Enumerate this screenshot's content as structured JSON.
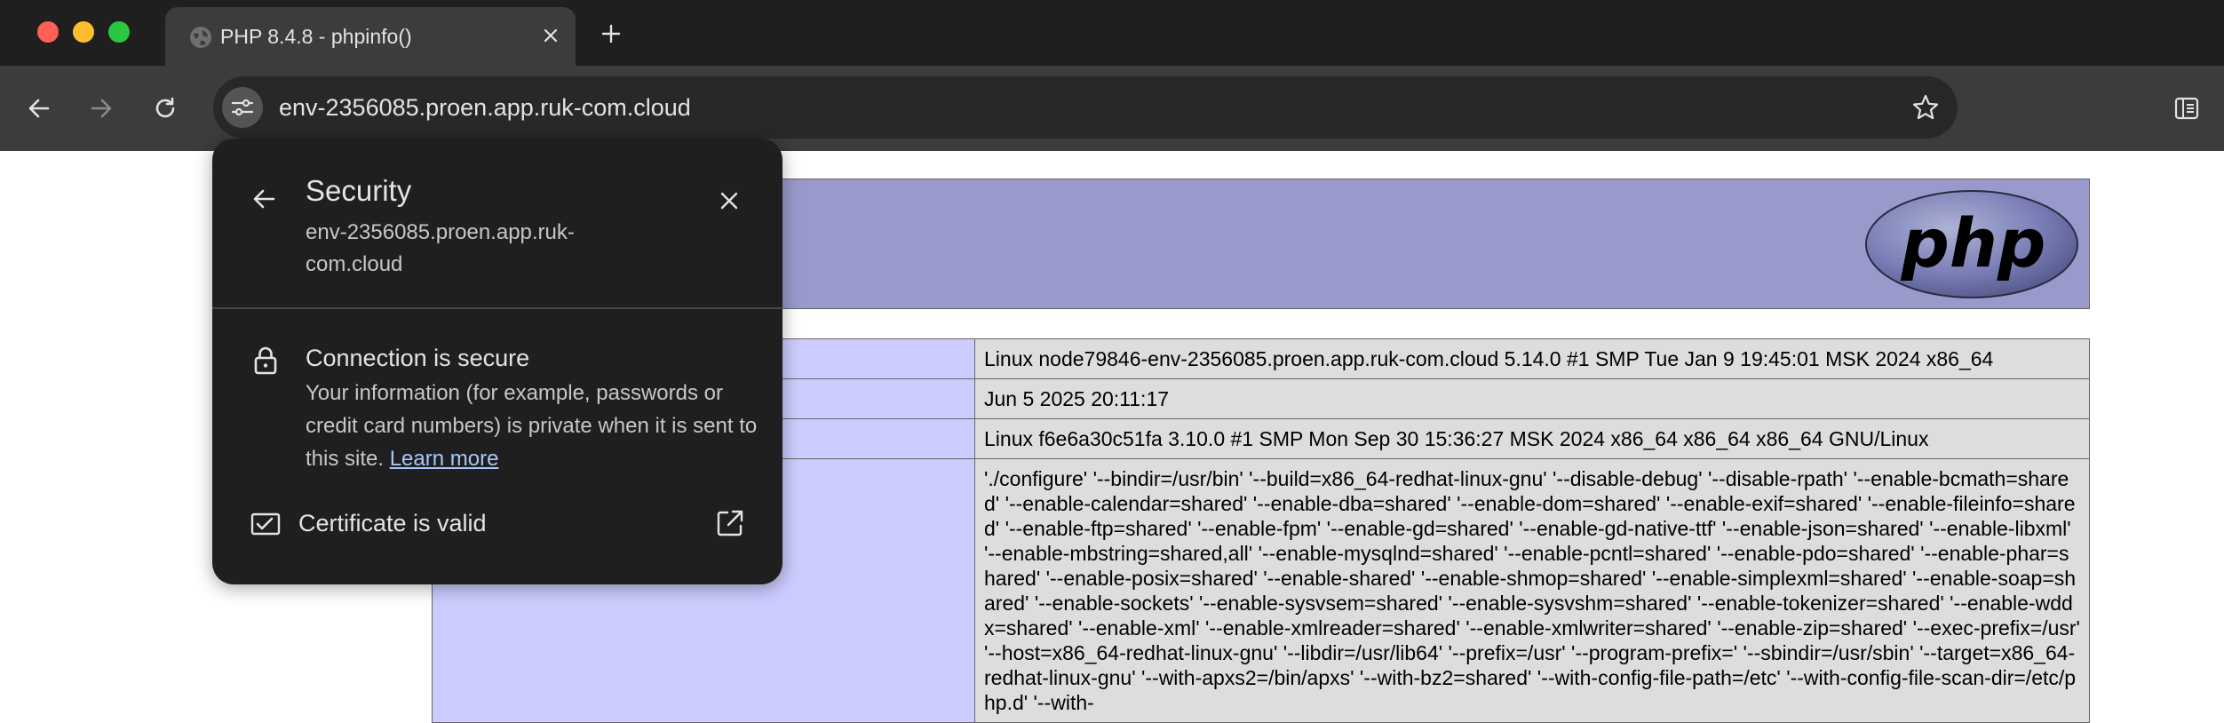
{
  "browser": {
    "tab": {
      "title": "PHP 8.4.8 - phpinfo()",
      "favicon": "globe-icon"
    },
    "toolbar": {
      "url": "env-2356085.proen.app.ruk-com.cloud",
      "icons": [
        "back-icon",
        "forward-icon",
        "reload-icon",
        "site-info-icon",
        "bookmark-star-icon",
        "side-panel-icon"
      ]
    }
  },
  "security_popup": {
    "title": "Security",
    "host": "env-2356085.proen.app.ruk-com.cloud",
    "connection_title": "Connection is secure",
    "connection_desc": "Your information (for example, passwords or credit card numbers) is private when it is sent to this site.",
    "learn_more": "Learn more",
    "certificate_label": "Certificate is valid"
  },
  "phpinfo": {
    "logo_text": "php",
    "rows": [
      {
        "key": "",
        "value": "Linux node79846-env-2356085.proen.app.ruk-com.cloud 5.14.0 #1 SMP Tue Jan 9 19:45:01 MSK 2024 x86_64"
      },
      {
        "key": "",
        "value": "Jun 5 2025 20:11:17"
      },
      {
        "key": "",
        "value": "Linux f6e6a30c51fa 3.10.0 #1 SMP Mon Sep 30 15:36:27 MSK 2024 x86_64 x86_64 x86_64 GNU/Linux"
      },
      {
        "key": "",
        "value": "'./configure' '--bindir=/usr/bin' '--build=x86_64-redhat-linux-gnu' '--disable-debug' '--disable-rpath' '--enable-bcmath=shared' '--enable-calendar=shared' '--enable-dba=shared' '--enable-dom=shared' '--enable-exif=shared' '--enable-fileinfo=shared' '--enable-ftp=shared' '--enable-fpm' '--enable-gd=shared' '--enable-gd-native-ttf' '--enable-json=shared' '--enable-libxml' '--enable-mbstring=shared,all' '--enable-mysqlnd=shared' '--enable-pcntl=shared' '--enable-pdo=shared' '--enable-phar=shared' '--enable-posix=shared' '--enable-shared' '--enable-shmop=shared' '--enable-simplexml=shared' '--enable-soap=shared' '--enable-sockets' '--enable-sysvsem=shared' '--enable-sysvshm=shared' '--enable-tokenizer=shared' '--enable-wddx=shared' '--enable-xml' '--enable-xmlreader=shared' '--enable-xmlwriter=shared' '--enable-zip=shared' '--exec-prefix=/usr' '--host=x86_64-redhat-linux-gnu' '--libdir=/usr/lib64' '--prefix=/usr' '--program-prefix=' '--sbindir=/usr/sbin' '--target=x86_64-redhat-linux-gnu' '--with-apxs2=/bin/apxs' '--with-bz2=shared' '--with-config-file-path=/etc' '--with-config-file-scan-dir=/etc/php.d' '--with-"
      }
    ]
  },
  "colors": {
    "header_bg": "#9999cc",
    "key_bg": "#ccccff",
    "value_bg": "#dddddd",
    "chrome_dark": "#1f1f1f",
    "toolbar": "#3c3c3c",
    "link": "#a8c7fa"
  }
}
